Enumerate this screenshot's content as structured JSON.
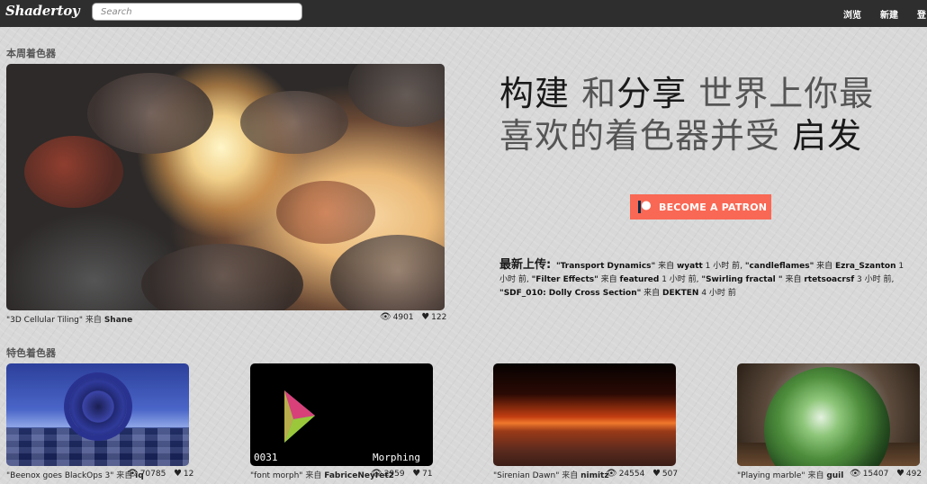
{
  "header": {
    "logo": "Shadertoy",
    "search_placeholder": "Search",
    "nav": {
      "browse": "浏览",
      "new": "新建",
      "login": "登"
    }
  },
  "weekly": {
    "title": "本周着色器",
    "shader": {
      "name": "\"3D Cellular Tiling\"",
      "by": "来自",
      "author": "Shane",
      "views": "4901",
      "likes": "122"
    }
  },
  "hero": {
    "line1_dark1": "构建",
    "line1_light1": " 和",
    "line1_dark2": "分享",
    "line1_light2": " 世界上你最",
    "line2_light": "喜欢的着色器并受 ",
    "line2_dark": "启发"
  },
  "patron": {
    "label": "BECOME A PATRON",
    "color": "#f96854"
  },
  "uploads": {
    "label": "最新上传:",
    "items": [
      {
        "name": "\"Transport Dynamics\"",
        "by": " 来自 ",
        "author": "wyatt",
        "time": " 1 小时 前, "
      },
      {
        "name": "\"candleflames\"",
        "by": " 来自 ",
        "author": "Ezra_Szanton",
        "time": " 1 小时 前, "
      },
      {
        "name": "\"Filter Effects\"",
        "by": " 来自 ",
        "author": "featured",
        "time": " 1 小时 前, "
      },
      {
        "name": "\"Swirling fractal \"",
        "by": " 来自 ",
        "author": "rtetsoacrsf",
        "time": " 3 小时 前, "
      },
      {
        "name": "\"SDF_010: Dolly Cross Section\"",
        "by": " 来自 ",
        "author": "DEKTEN",
        "time": " 4 小时 前"
      }
    ]
  },
  "featured": {
    "title": "特色着色器",
    "cards": [
      {
        "name": "\"Beenox goes BlackOps 3\"",
        "by": "来自",
        "author": "iq",
        "views": "70785",
        "likes": "12"
      },
      {
        "name": "\"font morph\"",
        "by": "来自",
        "author": "FabriceNeyret2",
        "views": "2959",
        "likes": "71",
        "overlay_num": "0031",
        "overlay_word": "Morphing"
      },
      {
        "name": "\"Sirenian Dawn\"",
        "by": "来自",
        "author": "nimitz",
        "views": "24554",
        "likes": "507"
      },
      {
        "name": "\"Playing marble\"",
        "by": "来自",
        "author": "guil",
        "views": "15407",
        "likes": "492"
      }
    ]
  }
}
